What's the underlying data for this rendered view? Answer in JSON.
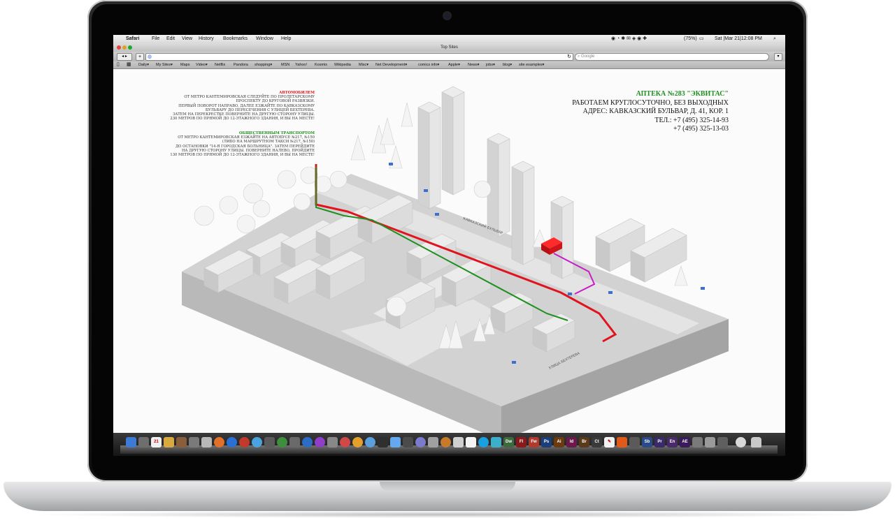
{
  "menubar": {
    "apple": "",
    "app": "Safari",
    "items": [
      "File",
      "Edit",
      "View",
      "History",
      "Bookmarks",
      "Window",
      "Help"
    ],
    "battery": "(75%)",
    "clock": "Sat |Mar 21|12:08 PM"
  },
  "window": {
    "title": "Top Sites"
  },
  "toolbar": {
    "url": "",
    "search_placeholder": "Google"
  },
  "bookmarks": {
    "items": [
      "Daily▾",
      "My Sites▾",
      "Maps",
      "Video▾",
      "Netflix",
      "Pandora",
      "shopping▾",
      "MSN",
      "Yahoo!",
      "Kosmix",
      "Wikipedia",
      "Misc▾",
      "Net Development▾",
      "comics info▾",
      "Apple▾",
      "News▾",
      "jobs▾",
      "blog▾",
      "site examples▾"
    ]
  },
  "page": {
    "car": {
      "heading": "АВТОМОБИЛЕМ",
      "lines": [
        "ОТ МЕТРО КАНТЕМИРОВСКАЯ СЛЕДУЙТЕ ПО ПРОЛЕТАРСКОМУ",
        "ПРОСПЕКТУ ДО КРУГОВОЙ РАЗВЯЗКИ.",
        "ПЕРВЫЙ ПОВОРОТ НАПРАВО, ДАЛЕЕ ЕЗЖАЙТЕ ПО КАВКАЗСКОМУ",
        "БУЛЬВАРУ ДО ПЕРЕСЕЧЕНИЯ С УЛИЦЕЙ БЕХТЕРЕВА.",
        "ЗАТЕМ НА ПЕРЕКРЕСТКЕ ПОВЕРНИТЕ НА ДРУГУЮ СТОРОНУ УЛИЦЫ.",
        "230 МЕТРОВ ПО ПРЯМОЙ ДО 12-ЭТАЖНОГО ЗДАНИЯ, И ВЫ НА МЕСТЕ!"
      ]
    },
    "transit": {
      "heading": "ОБЩЕСТВЕННЫМ ТРАНСПОРТОМ",
      "lines": [
        "ОТ МЕТРО КАНТЕМИРОВСКАЯ ЕЗЖАЙТЕ НА АВТОБУСЕ №217, №150",
        "(ЛИБО НА МАРШРУТНОМ ТАКСИ №217, №150)",
        "ДО ОСТАНОВКИ \"14-Я ГОРОДСКАЯ БОЛЬНИЦА\". ЗАТЕМ ПЕРЕЙДИТЕ",
        "НА ДРУГУЮ СТОРОНУ УЛИЦЫ. ПОВЕРНИТЕ НАЛЕВО, ПРОЙДИТЕ",
        "130 МЕТРОВ ПО ПРЯМОЙ ДО 12-ЭТАЖНОГО ЗДАНИЯ, И ВЫ НА МЕСТЕ!"
      ]
    },
    "pharmacy": {
      "name": "АПТЕКА №283 \"ЭКВИТАС\"",
      "hours": "РАБОТАЕМ КРУГЛОСУТОЧНО, БЕЗ ВЫХОДНЫХ",
      "address": "АДРЕС: КАВКАЗСКИЙ БУЛЬВАР, Д. 41, КОР. 1",
      "phone1": "ТЕЛ.: +7 (495) 325-14-93",
      "phone2": "+7 (495) 325-13-03"
    },
    "map": {
      "street_boulevard": "КАВКАЗСКИЙ БУЛЬВАР",
      "street_bekhtereva": "УЛИЦА БЕХТЕРЕВА",
      "colors": {
        "car_route": "#e0141e",
        "transit_route": "#1f8f1f",
        "walk_route": "#c81ec8",
        "destination": "#e0141e"
      }
    }
  },
  "dock": {
    "apps": [
      "finder-icon",
      "app-icon",
      "calendar-icon",
      "notes-icon",
      "app-icon",
      "photo-icon",
      "mail-icon",
      "text-icon",
      "firefox-icon",
      "app-icon",
      "app-icon",
      "app-icon",
      "app-icon",
      "app-icon",
      "app-icon",
      "app-icon",
      "app-icon",
      "app-icon",
      "app-icon",
      "app-icon",
      "app-icon",
      "app-icon",
      "app-icon",
      "app-icon",
      "app-icon",
      "app-icon",
      "app-icon",
      "app-icon",
      "app-icon",
      "app-icon",
      "app-icon"
    ],
    "labels": [
      "Dw",
      "Fl",
      "Fw",
      "Ps",
      "Ai",
      "Id",
      "Br",
      "Ct",
      "Sb",
      "Pr",
      "En",
      "AE"
    ]
  }
}
